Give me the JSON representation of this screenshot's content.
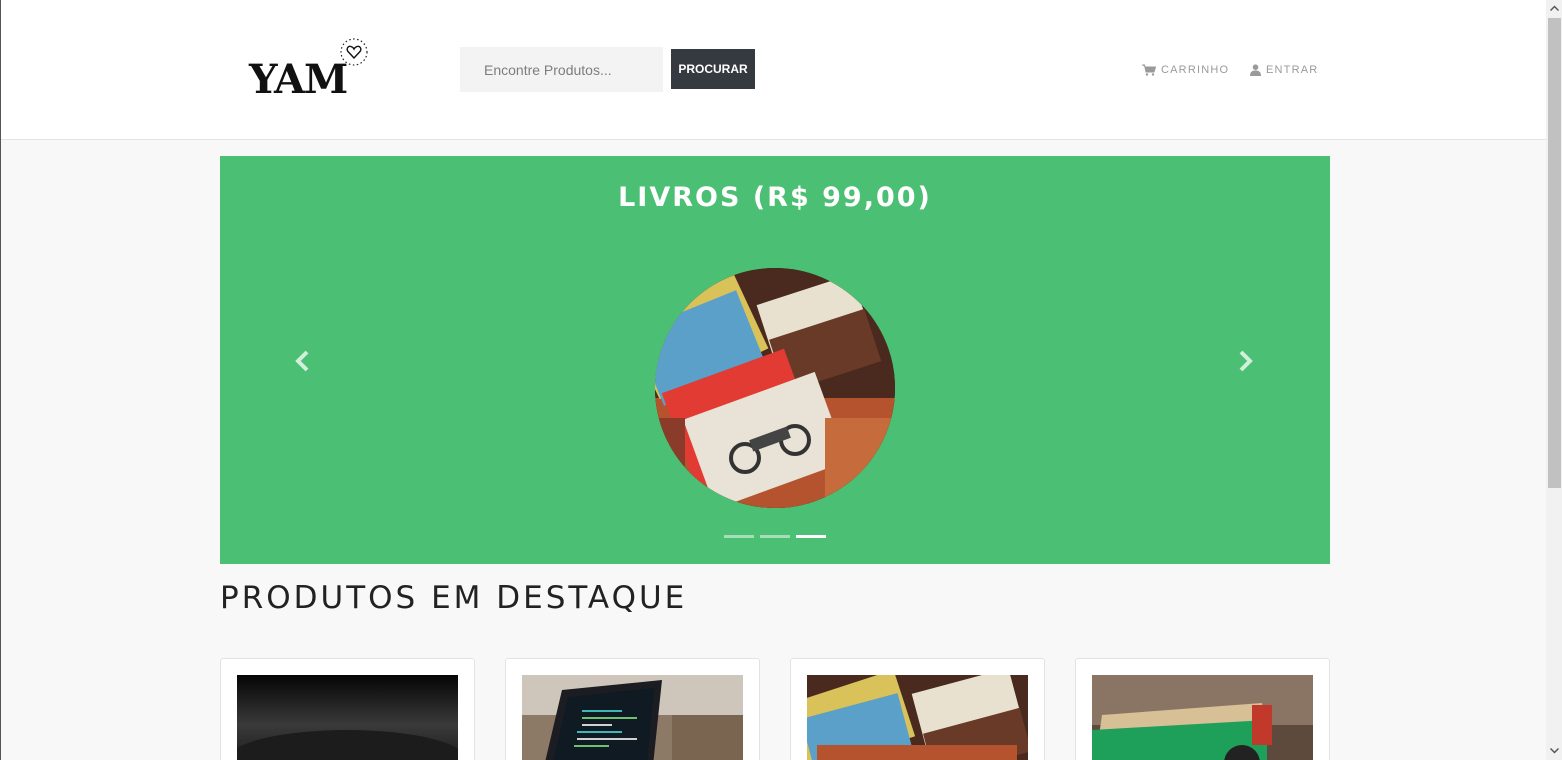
{
  "header": {
    "logo_text": "YAM",
    "search_placeholder": "Encontre Produtos...",
    "search_button": "PROCURAR",
    "nav": {
      "cart_label": "CARRINHO",
      "cart_icon": "cart-icon",
      "login_label": "ENTRAR",
      "login_icon": "user-icon"
    }
  },
  "carousel": {
    "title": "LIVROS (R$ 99,00)",
    "background_color": "#4bbf73",
    "slide_count": 3,
    "active_slide": 3,
    "prev_icon": "chevron-left-icon",
    "next_icon": "chevron-right-icon"
  },
  "featured": {
    "title": "PRODUTOS EM DESTAQUE",
    "cards": [
      {
        "image": "dark product photo"
      },
      {
        "image": "laptop with code"
      },
      {
        "image": "stack of magazines"
      },
      {
        "image": "toy truck with sand"
      }
    ]
  },
  "colors": {
    "accent_green": "#4bbf73",
    "button_dark": "#343a40"
  }
}
